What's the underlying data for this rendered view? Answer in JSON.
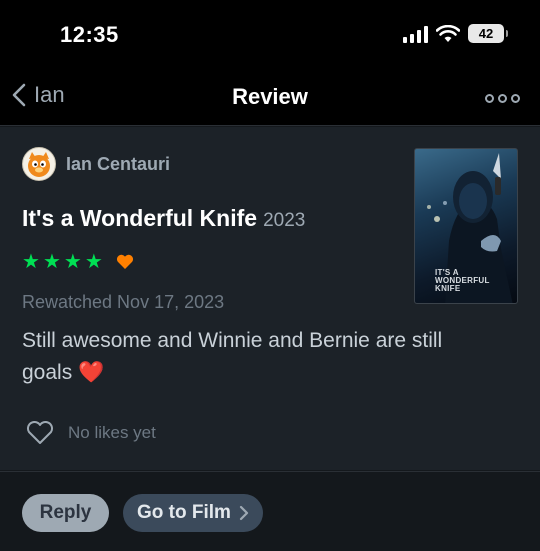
{
  "status_bar": {
    "time": "12:35",
    "battery": "42"
  },
  "nav": {
    "back_label": "Ian",
    "title": "Review"
  },
  "review": {
    "author": "Ian Centauri",
    "film_title": "It's a Wonderful Knife",
    "film_year": "2023",
    "rating_stars": 4,
    "liked": true,
    "watch_date": "Rewatched Nov 17, 2023",
    "text": "Still awesome and Winnie and Bernie are still goals ❤️",
    "likes_label": "No likes yet",
    "poster_title": "IT'S A WONDERFUL KNIFE"
  },
  "footer": {
    "reply_label": "Reply",
    "go_to_film_label": "Go to Film"
  },
  "colors": {
    "star": "#00e054",
    "heart": "#ff8000",
    "accent_text": "#9ea9b3"
  }
}
